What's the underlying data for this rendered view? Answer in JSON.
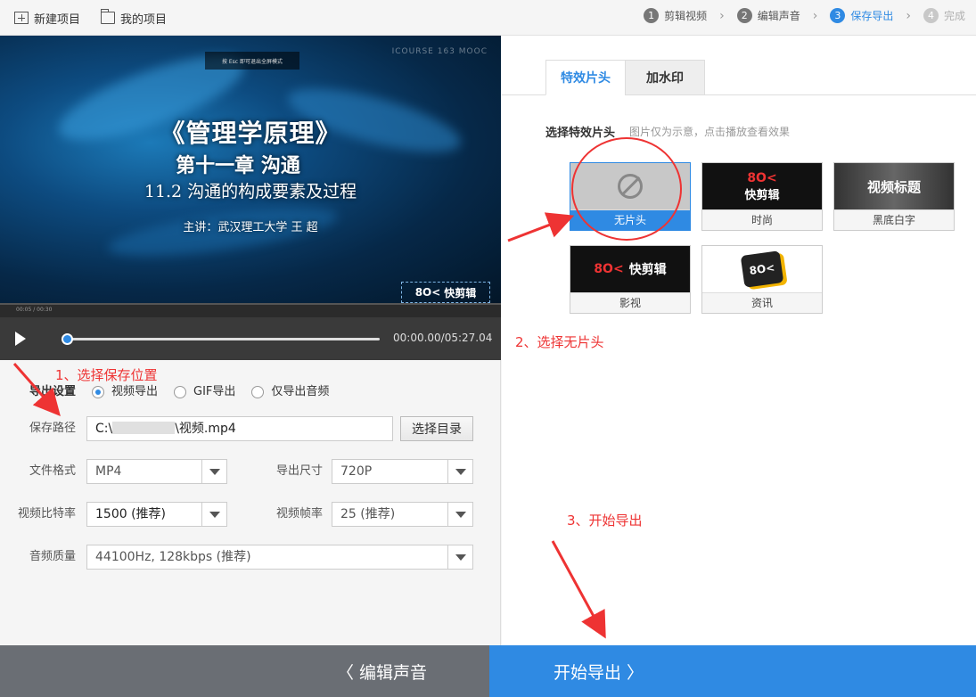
{
  "toolbar": {
    "new_project": "新建项目",
    "my_projects": "我的项目"
  },
  "steps": [
    {
      "num": "1",
      "label": "剪辑视频",
      "state": "normal"
    },
    {
      "num": "2",
      "label": "编辑声音",
      "state": "normal"
    },
    {
      "num": "3",
      "label": "保存导出",
      "state": "active"
    },
    {
      "num": "4",
      "label": "完成",
      "state": "pending"
    }
  ],
  "video": {
    "esc_hint": "按 Esc 即可退出全屏模式",
    "watermark": "ICOURSE 163 MOOC",
    "title_line1": "《管理学原理》",
    "title_line2": "第十一章  沟通",
    "title_line3": "11.2  沟通的构成要素及过程",
    "title_line4": "主讲：武汉理工大学  王  超",
    "logo_text": "快剪辑",
    "mini_time": "00:05 / 00:30"
  },
  "player": {
    "time": "00:00.00/05:27.04",
    "progress": 0.0
  },
  "export": {
    "settings_label": "导出设置",
    "options": [
      "视频导出",
      "GIF导出",
      "仅导出音频"
    ],
    "selected_option": "视频导出",
    "path_label": "保存路径",
    "path_prefix": "C:\\",
    "path_suffix": "\\视频.mp4",
    "choose_dir": "选择目录",
    "format_label": "文件格式",
    "format_value": "MP4",
    "size_label": "导出尺寸",
    "size_value": "720P",
    "bitrate_label": "视频比特率",
    "bitrate_value": "1500 (推荐)",
    "fps_label": "视频帧率",
    "fps_value": "25 (推荐)",
    "audio_label": "音频质量",
    "audio_value": "44100Hz, 128kbps (推荐)"
  },
  "right": {
    "tab_effects": "特效片头",
    "tab_watermark": "加水印",
    "choose_title": "选择特效片头",
    "choose_hint": "图片仅为示意，点击播放查看效果",
    "cards": [
      {
        "caption": "无片头",
        "thumb_text": "",
        "selected": true
      },
      {
        "caption": "时尚",
        "thumb_text": "快剪辑",
        "selected": false
      },
      {
        "caption": "黑底白字",
        "thumb_text": "视频标题",
        "selected": false
      },
      {
        "caption": "影视",
        "thumb_text": "快剪辑",
        "selected": false
      },
      {
        "caption": "资讯",
        "thumb_text": "",
        "selected": false
      }
    ]
  },
  "bottom": {
    "back": "〈  编辑声音",
    "export": "开始导出  〉"
  },
  "annotations": {
    "a1": "1、选择保存位置",
    "a2": "2、选择无片头",
    "a3": "3、开始导出"
  },
  "colors": {
    "accent": "#2f8ae3",
    "annotation": "#e33333",
    "bottom_gray": "#6a6e74"
  }
}
